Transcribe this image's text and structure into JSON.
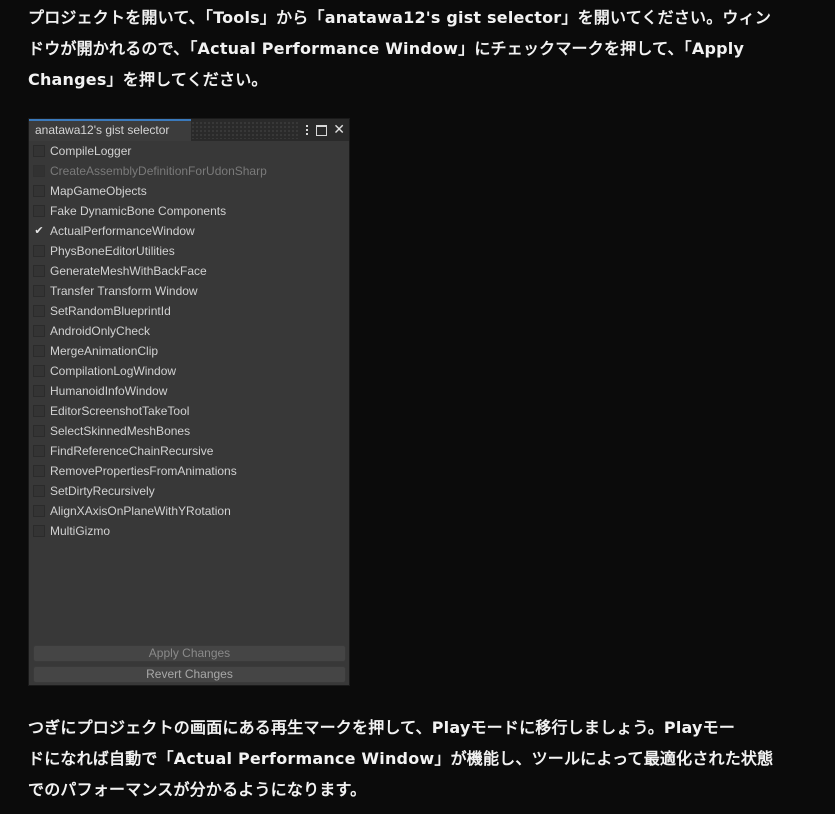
{
  "intro": {
    "lines": [
      "プロジェクトを開いて、「Tools」から「anatawa12's gist selector」を開いてください。ウィン",
      "ドウが開かれるので、「Actual Performance Window」にチェックマークを押して、「Apply",
      "Changes」を押してください。"
    ]
  },
  "window": {
    "tab_title": "anatawa12's gist selector",
    "icons": [
      "kebab-menu-icon",
      "maximize-icon",
      "close-icon"
    ],
    "items": [
      {
        "label": "CompileLogger",
        "checked": false,
        "disabled": false
      },
      {
        "label": "CreateAssemblyDefinitionForUdonSharp",
        "checked": false,
        "disabled": true
      },
      {
        "label": "MapGameObjects",
        "checked": false,
        "disabled": false
      },
      {
        "label": "Fake DynamicBone Components",
        "checked": false,
        "disabled": false
      },
      {
        "label": "ActualPerformanceWindow",
        "checked": true,
        "disabled": false
      },
      {
        "label": "PhysBoneEditorUtilities",
        "checked": false,
        "disabled": false
      },
      {
        "label": "GenerateMeshWithBackFace",
        "checked": false,
        "disabled": false
      },
      {
        "label": "Transfer Transform Window",
        "checked": false,
        "disabled": false
      },
      {
        "label": "SetRandomBlueprintId",
        "checked": false,
        "disabled": false
      },
      {
        "label": "AndroidOnlyCheck",
        "checked": false,
        "disabled": false
      },
      {
        "label": "MergeAnimationClip",
        "checked": false,
        "disabled": false
      },
      {
        "label": "CompilationLogWindow",
        "checked": false,
        "disabled": false
      },
      {
        "label": "HumanoidInfoWindow",
        "checked": false,
        "disabled": false
      },
      {
        "label": "EditorScreenshotTakeTool",
        "checked": false,
        "disabled": false
      },
      {
        "label": "SelectSkinnedMeshBones",
        "checked": false,
        "disabled": false
      },
      {
        "label": "FindReferenceChainRecursive",
        "checked": false,
        "disabled": false
      },
      {
        "label": "RemovePropertiesFromAnimations",
        "checked": false,
        "disabled": false
      },
      {
        "label": "SetDirtyRecursively",
        "checked": false,
        "disabled": false
      },
      {
        "label": "AlignXAxisOnPlaneWithYRotation",
        "checked": false,
        "disabled": false
      },
      {
        "label": "MultiGizmo",
        "checked": false,
        "disabled": false
      }
    ],
    "apply_label": "Apply Changes",
    "revert_label": "Revert Changes",
    "check_glyph": "✔"
  },
  "outro": {
    "lines": [
      "つぎにプロジェクトの画面にある再生マークを押して、Playモードに移行しましょう。Playモー",
      "ドになれば自動で「Actual Performance Window」が機能し、ツールによって最適化された状態",
      "でのパフォーマンスが分かるようになります。"
    ]
  },
  "colors": {
    "page_background": "#0b0b0b",
    "window_background": "#383838",
    "tab_accent": "#3a79bb"
  }
}
